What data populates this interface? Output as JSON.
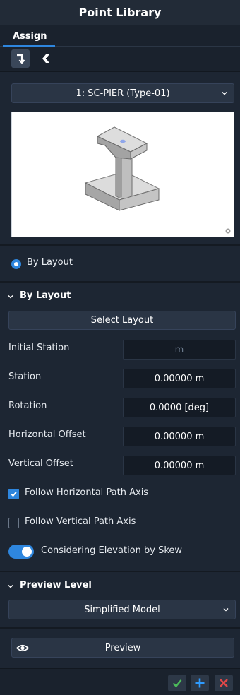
{
  "window": {
    "title": "Point Library"
  },
  "tabs": [
    {
      "label": "Assign"
    }
  ],
  "toolbar": {
    "buttons": [
      {
        "icon": "assign-arrow-icon",
        "active": true
      },
      {
        "icon": "flip-icon",
        "active": false
      }
    ]
  },
  "library": {
    "selected": "1: SC-PIER (Type-01)"
  },
  "mode": {
    "radio_label": "By Layout"
  },
  "by_layout": {
    "header": "By Layout",
    "select_layout_label": "Select Layout",
    "initial_station": {
      "label": "Initial Station",
      "value": "m"
    },
    "station": {
      "label": "Station",
      "value": "0.00000 m"
    },
    "rotation": {
      "label": "Rotation",
      "value": "0.0000 [deg]"
    },
    "horizontal_offset": {
      "label": "Horizontal Offset",
      "value": "0.00000 m"
    },
    "vertical_offset": {
      "label": "Vertical Offset",
      "value": "0.00000 m"
    },
    "follow_horizontal": {
      "label": "Follow Horizontal Path Axis",
      "checked": true
    },
    "follow_vertical": {
      "label": "Follow Vertical Path Axis",
      "checked": false
    },
    "considering_elevation": {
      "label": "Considering Elevation by Skew",
      "on": true
    }
  },
  "preview_level": {
    "header": "Preview Level",
    "selected": "Simplified Model"
  },
  "preview": {
    "button_label": "Preview"
  },
  "colors": {
    "accent": "#2e86de",
    "ok": "#4cbb5a",
    "add": "#2e9bff",
    "cancel": "#e04848"
  },
  "footer": {
    "icons": [
      "check-icon",
      "plus-icon",
      "close-icon"
    ]
  }
}
